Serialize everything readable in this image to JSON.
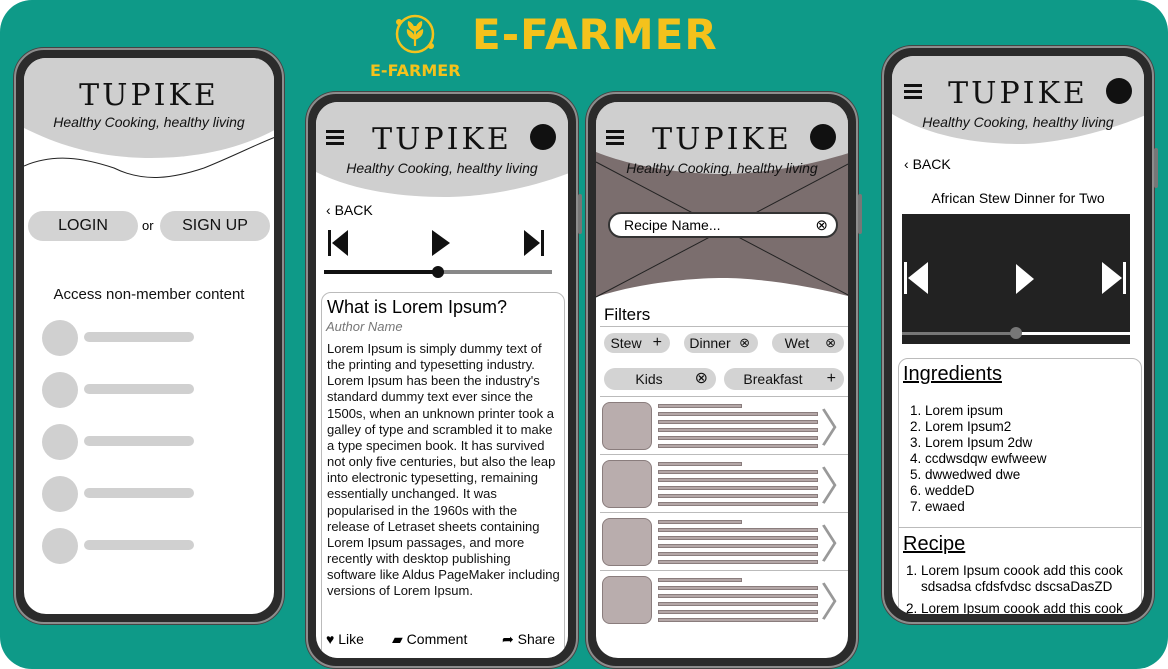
{
  "brand": {
    "logo_icon": "leaf-circle-icon",
    "small_label": "E-FARMER",
    "title": "E-FARMER",
    "accent": "#f4c21c",
    "background": "#0e9a88"
  },
  "app": {
    "name": "TUPIKE",
    "tagline": "Healthy Cooking, healthy living"
  },
  "phone1": {
    "login_label": "LOGIN",
    "or_label": "or",
    "signup_label": "SIGN UP",
    "nonmember_heading": "Access non-member content"
  },
  "phone2": {
    "back_label": "BACK",
    "article_title": "What is Lorem Ipsum?",
    "author": "Author Name",
    "body": "Lorem Ipsum is simply dummy text of the printing and typesetting industry. Lorem Ipsum has been the industry's standard dummy text ever since the 1500s, when an unknown printer took a galley of type and scrambled it to make a type specimen book. It has survived not only five centuries, but also the leap into electronic typesetting, remaining essentially unchanged. It was popularised in the 1960s with the release of Letraset sheets containing Lorem Ipsum passages, and more recently with desktop publishing software like Aldus PageMaker including versions of Lorem Ipsum.",
    "like_label": "Like",
    "comment_label": "Comment",
    "share_label": "Share",
    "progress": 0.5
  },
  "phone3": {
    "search_placeholder": "Recipe Name...",
    "filters_heading": "Filters",
    "chips": {
      "stew": "Stew",
      "dinner": "Dinner",
      "wet": "Wet",
      "kids": "Kids",
      "breakfast": "Breakfast"
    }
  },
  "phone4": {
    "back_label": "BACK",
    "video_title": "African Stew Dinner for Two",
    "progress": 0.5,
    "ingredients_heading": "Ingredients",
    "ingredients": [
      "Lorem ipsum",
      "Lorem Ipsum2",
      "Lorem Ipsum 2dw",
      "ccdwsdqw ewfweew",
      "dwwedwed dwe",
      "weddeD",
      "ewaed"
    ],
    "recipe_heading": "Recipe",
    "steps": [
      "Lorem Ipsum coook add this cook sdsadsa cfdsfvdsc dscsaDasZD",
      "Lorem Ipsum coook add this cook"
    ]
  }
}
